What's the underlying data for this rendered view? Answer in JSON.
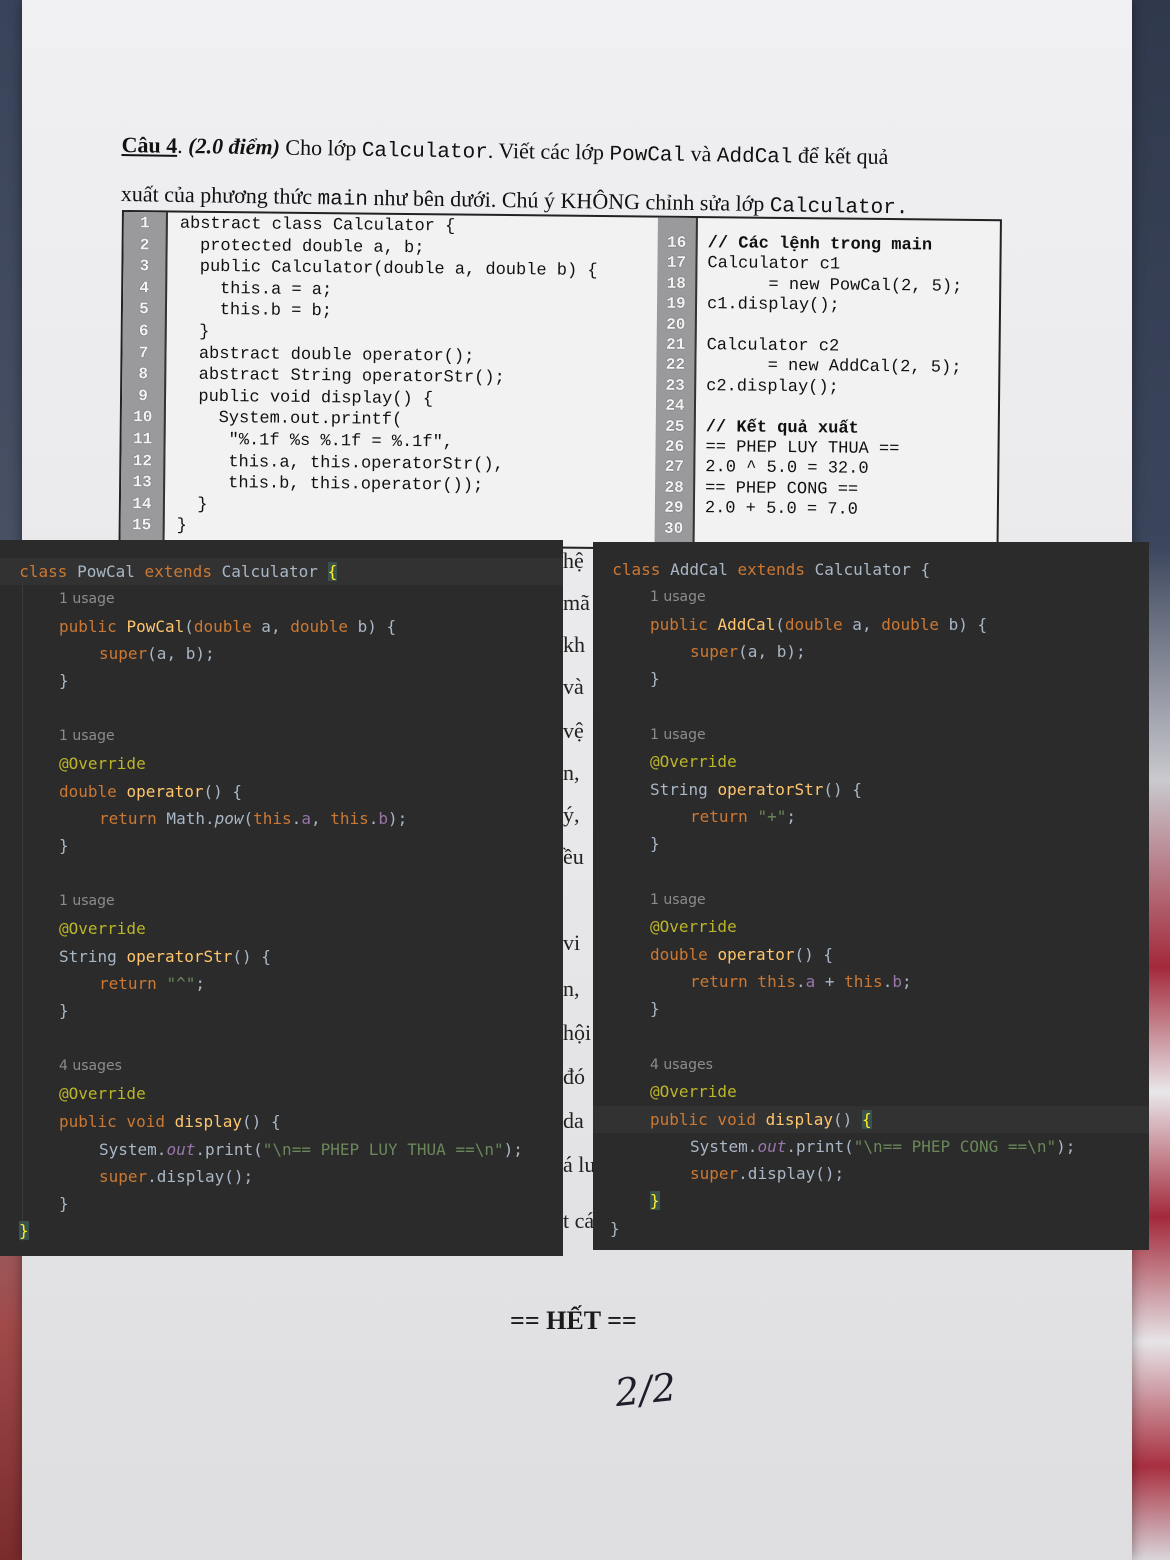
{
  "question": {
    "number": "Câu 4",
    "points": "(2.0 điểm)",
    "text_before": "Cho lớp",
    "class_name": "Calculator",
    "text_mid": ". Viết các lớp",
    "class_a": "PowCal",
    "and": "và",
    "class_b": "AddCal",
    "text_after": "để kết quả",
    "line2_before": "xuất của phương thức",
    "main": "main",
    "line2_after": "như bên dưới. Chú ý KHÔNG chỉnh sửa lớp",
    "class_name2": "Calculator."
  },
  "left_code": [
    {
      "n": "1",
      "code": "abstract class Calculator {"
    },
    {
      "n": "2",
      "code": "  protected double a, b;"
    },
    {
      "n": "3",
      "code": "  public Calculator(double a, double b) {"
    },
    {
      "n": "4",
      "code": "    this.a = a;"
    },
    {
      "n": "5",
      "code": "    this.b = b;"
    },
    {
      "n": "6",
      "code": "  }"
    },
    {
      "n": "7",
      "code": "  abstract double operator();"
    },
    {
      "n": "8",
      "code": "  abstract String operatorStr();"
    },
    {
      "n": "9",
      "code": "  public void display() {"
    },
    {
      "n": "10",
      "code": "    System.out.printf("
    },
    {
      "n": "11",
      "code": "     \"%.1f %s %.1f = %.1f\","
    },
    {
      "n": "12",
      "code": "     this.a, this.operatorStr(),"
    },
    {
      "n": "13",
      "code": "     this.b, this.operator());"
    },
    {
      "n": "14",
      "code": "  }"
    },
    {
      "n": "15",
      "code": "}"
    }
  ],
  "right_code": [
    {
      "n": "16",
      "code": "// Các lệnh trong main",
      "bold": true
    },
    {
      "n": "17",
      "code": "Calculator c1"
    },
    {
      "n": "18",
      "code": "      = new PowCal(2, 5);"
    },
    {
      "n": "19",
      "code": "c1.display();"
    },
    {
      "n": "20",
      "code": ""
    },
    {
      "n": "21",
      "code": "Calculator c2"
    },
    {
      "n": "22",
      "code": "      = new AddCal(2, 5);"
    },
    {
      "n": "23",
      "code": "c2.display();"
    },
    {
      "n": "24",
      "code": ""
    },
    {
      "n": "25",
      "code": "// Kết quả xuất",
      "bold": true
    },
    {
      "n": "26",
      "code": "== PHEP LUY THUA =="
    },
    {
      "n": "27",
      "code": "2.0 ^ 5.0 = 32.0"
    },
    {
      "n": "28",
      "code": "== PHEP CONG =="
    },
    {
      "n": "29",
      "code": "2.0 + 5.0 = 7.0"
    },
    {
      "n": "30",
      "code": ""
    }
  ],
  "peek_text": [
    "hệ",
    "mã",
    "kh",
    "và",
    "vệ",
    "n,",
    "ý,",
    "ều",
    "vi",
    "n,",
    "hội",
    "đó",
    "da",
    "á lu",
    "t cá"
  ],
  "pow_panel": {
    "usage1": "1 usage",
    "usage2": "1 usage",
    "usage3": "1 usage",
    "usage4": "4 usages",
    "class_kw": "class",
    "class_name": "PowCal",
    "extends_kw": "extends",
    "super_name": "Calculator",
    "annotation": "@Override",
    "print_text": "\\n== PHEP LUY THUA ==\\n",
    "op_symbol": "^"
  },
  "add_panel": {
    "usage1": "1 usage",
    "usage2": "1 usage",
    "usage3": "4 usages",
    "class_kw": "class",
    "class_name": "AddCal",
    "extends_kw": "extends",
    "super_name": "Calculator",
    "annotation": "@Override",
    "print_text": "\\n== PHEP CONG ==\\n",
    "op_symbol": "+"
  },
  "footer": {
    "end": "== HẾT ==",
    "page": "2/2"
  }
}
